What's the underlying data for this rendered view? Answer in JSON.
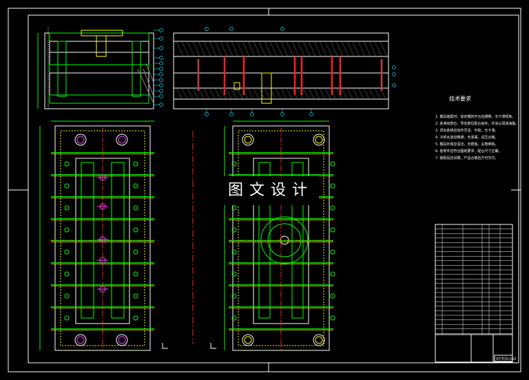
{
  "watermark": "图文设计",
  "notes": {
    "title": "技术要求",
    "lines": [
      "1. 模具装配时，动定模的开合应顺畅，无卡滞现象。",
      "2. 各滑动部位、导向部位配合良好，并涂以润滑油脂。",
      "3. 顶出系统应动作灵活、平稳，无卡滞。",
      "4. 冷却水道应畅通，无渗漏，试压合格。",
      "5. 模具外观应清洁，无锈蚀，尖角倒钝。",
      "6. 各零件应符合图纸要求，配合尺寸正确。",
      "7. 装配后应试模，产品合格后方可交付。"
    ]
  },
  "title_block": {
    "drawing_no": "ST/TDS-010",
    "part_rows": 24
  },
  "colors": {
    "background": "#000000",
    "line_white": "#ffffff",
    "outline_green": "#00ff00",
    "center_red": "#ff2020",
    "magenta": "#ff40ff",
    "yellow": "#ffff00",
    "cyan": "#00e0ff",
    "brown_red": "#c04040"
  }
}
